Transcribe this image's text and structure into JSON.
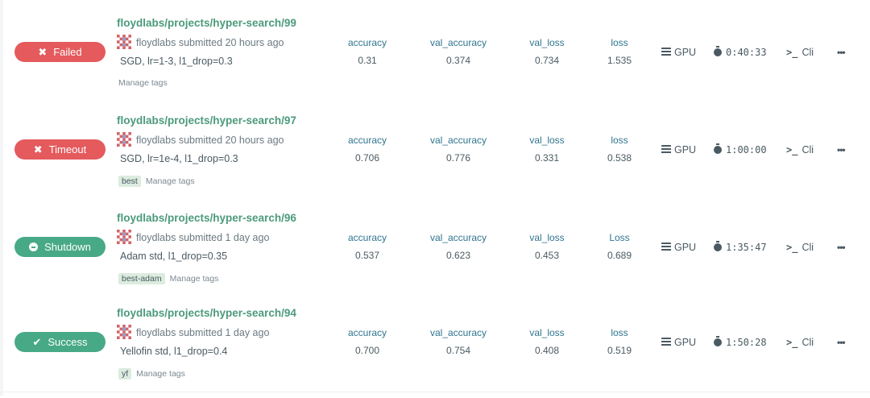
{
  "colors": {
    "failed": "#e45a5d",
    "success": "#48a987",
    "link": "#4c9a7b",
    "metric_name": "#2f7590"
  },
  "avatar_icon": "pixel-identicon",
  "runs": [
    {
      "status": "Failed",
      "status_icon": "x-icon",
      "title": "floydlabs/projects/hyper-search/99",
      "owner": "floydlabs",
      "submitted": "submitted 20 hours ago",
      "message": "SGD, lr=1-3, l1_drop=0.3",
      "tags": [],
      "manage_tags": "Manage tags",
      "metrics": [
        {
          "name": "accuracy",
          "value": "0.31"
        },
        {
          "name": "val_accuracy",
          "value": "0.374"
        },
        {
          "name": "val_loss",
          "value": "0.734"
        },
        {
          "name": "loss",
          "value": "1.535"
        }
      ],
      "instance": "GPU",
      "duration": "0:40:33",
      "cli": "Cli",
      "more": "•••"
    },
    {
      "status": "Timeout",
      "status_icon": "x-icon",
      "title": "floydlabs/projects/hyper-search/97",
      "owner": "floydlabs",
      "submitted": "submitted 20 hours ago",
      "message": "SGD, lr=1e-4, l1_drop=0.3",
      "tags": [
        "best"
      ],
      "manage_tags": "Manage tags",
      "metrics": [
        {
          "name": "accuracy",
          "value": "0.706"
        },
        {
          "name": "val_accuracy",
          "value": "0.776"
        },
        {
          "name": "val_loss",
          "value": "0.331"
        },
        {
          "name": "loss",
          "value": "0.538"
        }
      ],
      "instance": "GPU",
      "duration": "1:00:00",
      "cli": "Cli",
      "more": "•••"
    },
    {
      "status": "Shutdown",
      "status_icon": "minus-circle-icon",
      "title": "floydlabs/projects/hyper-search/96",
      "owner": "floydlabs",
      "submitted": "submitted 1 day ago",
      "message": "Adam std, l1_drop=0.35",
      "tags": [
        "best-adam"
      ],
      "manage_tags": "Manage tags",
      "metrics": [
        {
          "name": "accuracy",
          "value": "0.537"
        },
        {
          "name": "val_accuracy",
          "value": "0.623"
        },
        {
          "name": "val_loss",
          "value": "0.453"
        },
        {
          "name": "Loss",
          "value": "0.689"
        }
      ],
      "instance": "GPU",
      "duration": "1:35:47",
      "cli": "Cli",
      "more": "•••"
    },
    {
      "status": "Success",
      "status_icon": "check-icon",
      "title": "floydlabs/projects/hyper-search/94",
      "owner": "floydlabs",
      "submitted": "submitted 1 day ago",
      "message": "Yellofin std, l1_drop=0.4",
      "tags": [
        "yf"
      ],
      "manage_tags": "Manage tags",
      "metrics": [
        {
          "name": "accuracy",
          "value": "0.700"
        },
        {
          "name": "val_accuracy",
          "value": "0.754"
        },
        {
          "name": "val_loss",
          "value": "0.408"
        },
        {
          "name": "loss",
          "value": "0.519"
        }
      ],
      "instance": "GPU",
      "duration": "1:50:28",
      "cli": "Cli",
      "more": "•••"
    }
  ]
}
